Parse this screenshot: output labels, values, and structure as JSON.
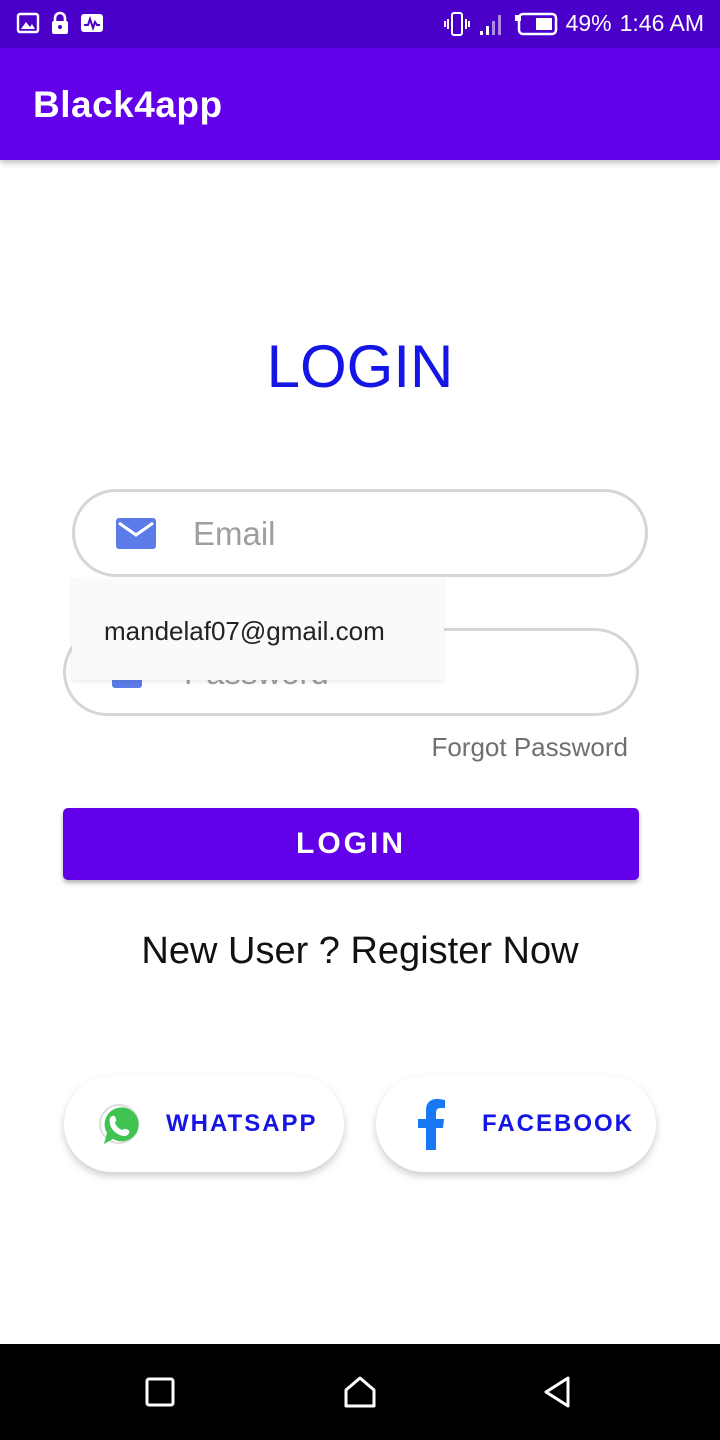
{
  "status_bar": {
    "battery": "49%",
    "time": "1:46 AM",
    "left_icons": [
      "image-icon",
      "lock-icon",
      "activity-icon"
    ],
    "right_icons": [
      "vibrate-icon",
      "signal-icon",
      "battery-icon"
    ]
  },
  "app_bar": {
    "title": "Black4app"
  },
  "login": {
    "heading": "LOGIN",
    "email_placeholder": "Email",
    "password_placeholder": "Password",
    "autofill_suggestion": "mandelaf07@gmail.com",
    "forgot_password": "Forgot Password",
    "button_label": "LOGIN",
    "register_text": "New User ? Register Now"
  },
  "social": {
    "whatsapp_label": "WHATSAPP",
    "facebook_label": "FACEBOOK"
  },
  "nav_bar": {
    "icons": [
      "recents-icon",
      "home-icon",
      "back-icon"
    ]
  },
  "colors": {
    "status_bar": "#4a00c8",
    "primary": "#6200ea",
    "heading_blue": "#1515e6",
    "email_icon": "#5b7be8",
    "whatsapp_green": "#40c351",
    "facebook_blue": "#1877f2"
  }
}
